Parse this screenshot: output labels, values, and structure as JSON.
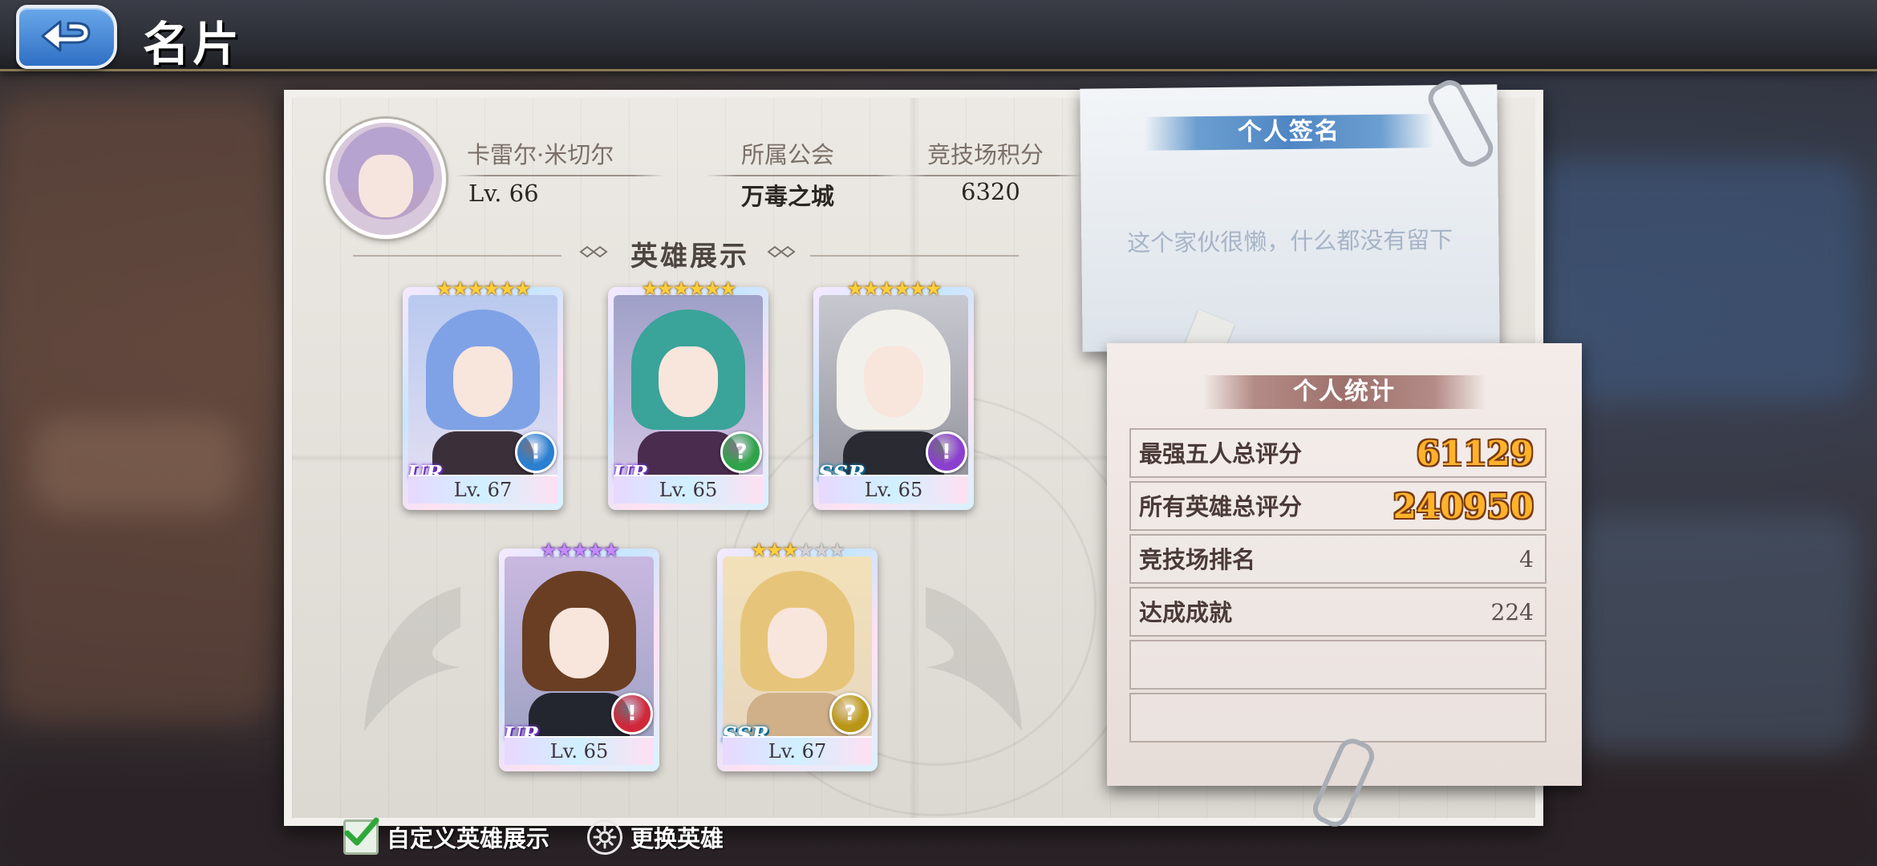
{
  "header": {
    "title": "名片",
    "back_icon": "back-arrow-icon"
  },
  "profile": {
    "name": "卡雷尔·米切尔",
    "level": "Lv. 66",
    "guild_label": "所属公会",
    "guild_value": "万毒之城",
    "arena_points_label": "竞技场积分",
    "arena_points_value": "6320"
  },
  "hero_showcase": {
    "title": "英雄展示",
    "heroes": [
      {
        "rarity": "UR",
        "level": "Lv. 67",
        "stars": 6,
        "max_stars": 6,
        "star_color": "gold",
        "element": "ice",
        "element_color": "#2a7fd0"
      },
      {
        "rarity": "UR",
        "level": "Lv. 65",
        "stars": 6,
        "max_stars": 6,
        "star_color": "gold",
        "element": "mystery",
        "element_color": "#2fa34a"
      },
      {
        "rarity": "SSR",
        "level": "Lv. 65",
        "stars": 6,
        "max_stars": 6,
        "star_color": "gold",
        "element": "dark",
        "element_color": "#8b3fcf"
      },
      {
        "rarity": "UR",
        "level": "Lv. 65",
        "stars": 5,
        "max_stars": 5,
        "star_color": "purple",
        "element": "fire",
        "element_color": "#d0283a"
      },
      {
        "rarity": "SSR",
        "level": "Lv. 67",
        "stars": 3,
        "max_stars": 6,
        "star_color": "gold",
        "element": "light",
        "element_color": "#b89515"
      }
    ]
  },
  "signature": {
    "title": "个人签名",
    "text": "这个家伙很懒，什么都没有留下"
  },
  "stats": {
    "title": "个人统计",
    "rows": [
      {
        "label": "最强五人总评分",
        "value": "61129"
      },
      {
        "label": "所有英雄总评分",
        "value": "240950"
      },
      {
        "label": "竞技场排名",
        "value": "4"
      },
      {
        "label": "达成成就",
        "value": "224"
      },
      {
        "label": "",
        "value": ""
      },
      {
        "label": "",
        "value": ""
      }
    ]
  },
  "controls": {
    "custom_showcase_label": "自定义英雄展示",
    "custom_showcase_checked": true,
    "change_hero_label": "更换英雄"
  },
  "colors": {
    "accent_blue": "#4f86c4",
    "accent_rose": "#9e716c",
    "score_gold": "#ffb22b"
  }
}
